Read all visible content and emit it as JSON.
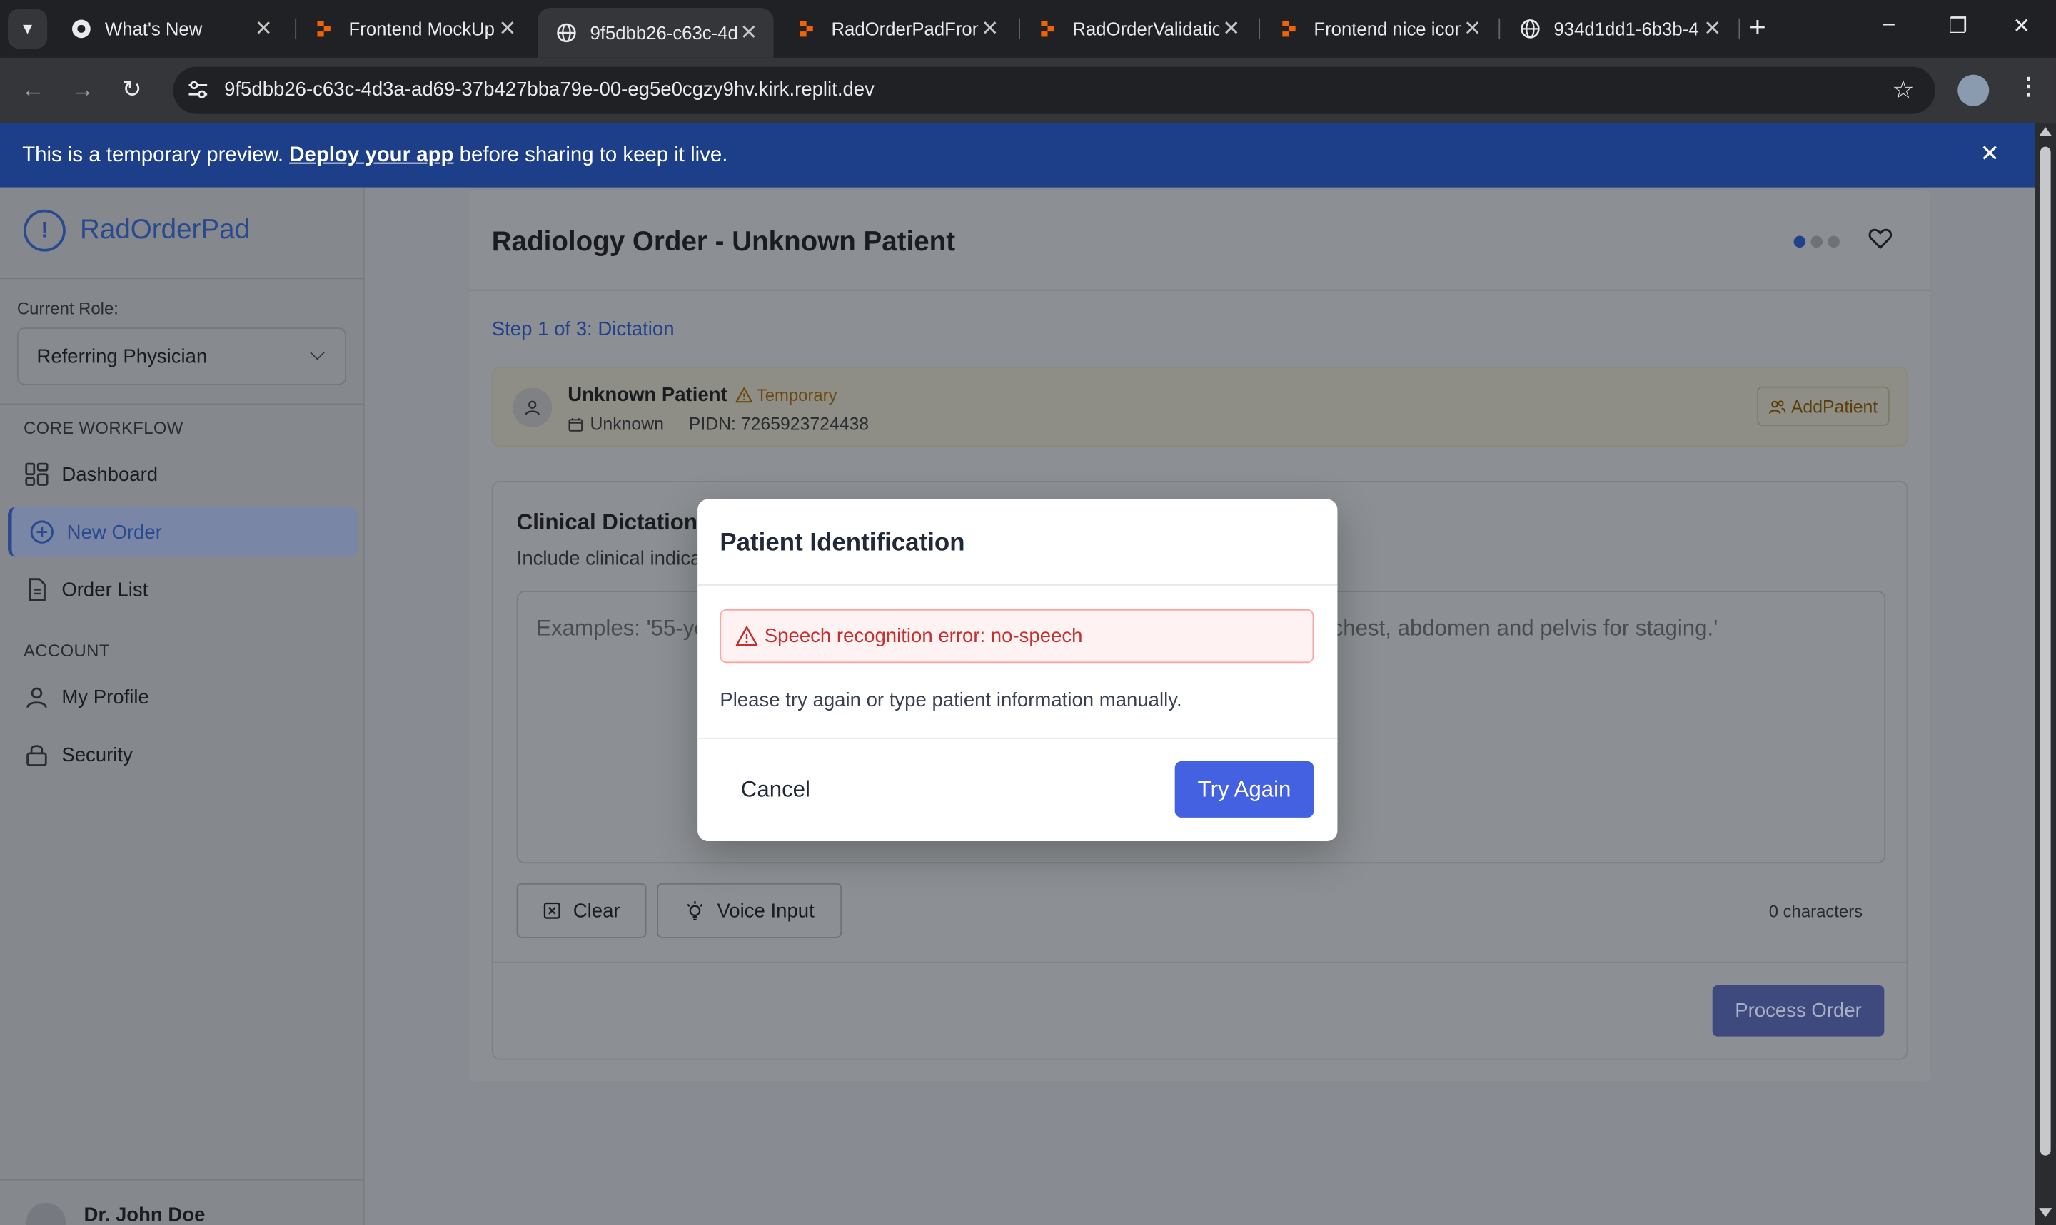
{
  "browser": {
    "tabs": [
      {
        "title": "What's New",
        "icon": "chrome-icon"
      },
      {
        "title": "Frontend MockUp",
        "icon": "replit-icon"
      },
      {
        "title": "9f5dbb26-c63c-4d",
        "icon": "globe-icon",
        "active": true
      },
      {
        "title": "RadOrderPadFront",
        "icon": "replit-icon"
      },
      {
        "title": "RadOrderValidatio",
        "icon": "replit-icon"
      },
      {
        "title": "Frontend nice icon",
        "icon": "replit-icon"
      },
      {
        "title": "934d1dd1-6b3b-4",
        "icon": "globe-icon"
      }
    ],
    "url": "9f5dbb26-c63c-4d3a-ad69-37b427bba79e-00-eg5e0cgzy9hv.kirk.replit.dev"
  },
  "banner": {
    "text_before": "This is a temporary preview.",
    "link": "Deploy your app",
    "text_after": "before sharing to keep it live."
  },
  "sidebar": {
    "app_name": "RadOrderPad",
    "role_label": "Current Role:",
    "role_value": "Referring Physician",
    "core_label": "CORE WORKFLOW",
    "core_items": [
      {
        "label": "Dashboard",
        "icon": "dashboard-icon"
      },
      {
        "label": "New Order",
        "icon": "plus-circle-icon",
        "active": true
      },
      {
        "label": "Order List",
        "icon": "document-icon"
      }
    ],
    "account_label": "ACCOUNT",
    "account_items": [
      {
        "label": "My Profile",
        "icon": "user-icon"
      },
      {
        "label": "Security",
        "icon": "lock-icon"
      }
    ],
    "user_name": "Dr. John Doe"
  },
  "main": {
    "title": "Radiology Order - Unknown Patient",
    "step": "Step 1 of 3: Dictation",
    "patient": {
      "name": "Unknown Patient",
      "badge": "Temporary",
      "dob": "Unknown",
      "pidn": "PIDN: 7265923724438",
      "add_label": "AddPatient"
    },
    "dictation": {
      "title": "Clinical Dictation",
      "subtitle": "Include clinical indications, relevant history, and exam requested",
      "placeholder": "Examples: '55-year-old female with newly diagnosed breast cancer. Request CT chest, abdomen and pelvis for staging.'",
      "clear_label": "Clear",
      "voice_label": "Voice Input",
      "char_count": "0 characters",
      "process_label": "Process Order"
    }
  },
  "modal": {
    "title": "Patient Identification",
    "error": "Speech recognition error: no-speech",
    "message": "Please try again or type patient information manually.",
    "cancel_label": "Cancel",
    "retry_label": "Try Again"
  },
  "colors": {
    "brand": "#23408a",
    "banner": "#1d3e89",
    "primary_button": "#4361e0",
    "error": "#c53030"
  }
}
